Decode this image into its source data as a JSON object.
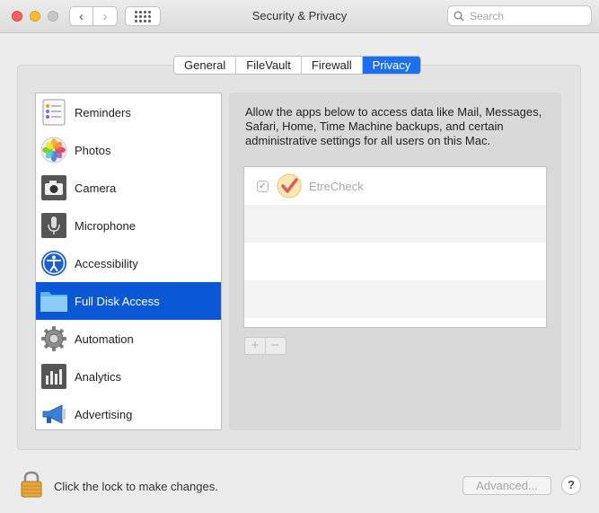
{
  "window": {
    "title": "Security & Privacy",
    "search_placeholder": "Search"
  },
  "tabs": [
    {
      "label": "General",
      "active": false
    },
    {
      "label": "FileVault",
      "active": false
    },
    {
      "label": "Firewall",
      "active": false
    },
    {
      "label": "Privacy",
      "active": true
    }
  ],
  "services": [
    {
      "label": "Reminders",
      "icon": "reminders-icon"
    },
    {
      "label": "Photos",
      "icon": "photos-icon"
    },
    {
      "label": "Camera",
      "icon": "camera-icon"
    },
    {
      "label": "Microphone",
      "icon": "microphone-icon"
    },
    {
      "label": "Accessibility",
      "icon": "accessibility-icon"
    },
    {
      "label": "Full Disk Access",
      "icon": "folder-icon",
      "selected": true
    },
    {
      "label": "Automation",
      "icon": "gear-icon"
    },
    {
      "label": "Analytics",
      "icon": "analytics-icon"
    },
    {
      "label": "Advertising",
      "icon": "megaphone-icon"
    }
  ],
  "pane": {
    "description": "Allow the apps below to access data like Mail, Messages, Safari, Home, Time Machine backups, and certain administrative settings for all users on this Mac.",
    "apps": [
      {
        "name": "EtreCheck",
        "checked": true,
        "icon": "etrecheck-icon"
      }
    ],
    "add_label": "+",
    "remove_label": "−"
  },
  "footer": {
    "lock_text": "Click the lock to make changes.",
    "advanced_label": "Advanced...",
    "help_label": "?"
  },
  "colors": {
    "accent": "#0b58d6",
    "tab_active": "#1d6ff2"
  }
}
